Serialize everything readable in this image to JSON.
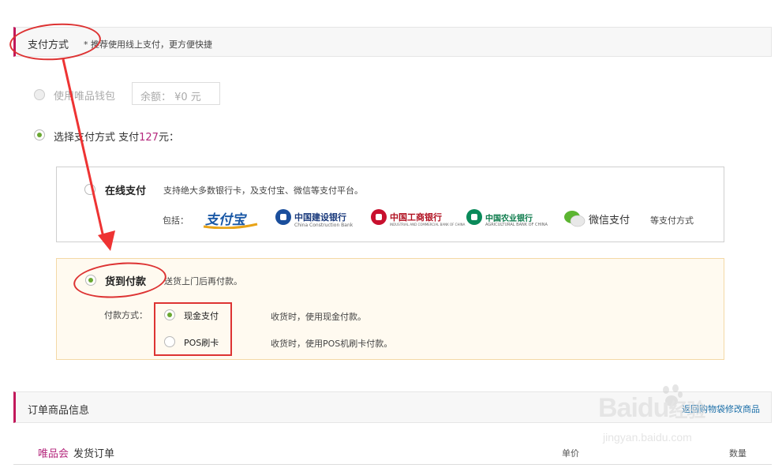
{
  "payment_section": {
    "title": "支付方式",
    "note": "* 推荐使用线上支付，更方便快捷"
  },
  "wallet": {
    "label": "使用唯品钱包",
    "balance": "余额： ¥0 元"
  },
  "choose": {
    "label_prefix": "选择支付方式 支付",
    "amount": "127",
    "label_suffix": "元："
  },
  "online": {
    "title": "在线支付",
    "desc": "支持绝大多数银行卡，及支付宝、微信等支付平台。",
    "includes_label": "包括：",
    "partners": [
      "支付宝",
      "中国建设银行",
      "中国工商银行",
      "中国农业银行",
      "微信支付"
    ],
    "partner_subtitles": [
      "China Construction Bank",
      "INDUSTRIAL AND COMMERCIAL BANK OF CHINA",
      "AGRICULTURAL BANK OF CHINA"
    ],
    "etc": "等支付方式"
  },
  "cod": {
    "title": "货到付款",
    "desc": "送货上门后再付款。",
    "method_label": "付款方式：",
    "options": [
      {
        "label": "现金支付",
        "desc": "收货时，使用现金付款。",
        "checked": true
      },
      {
        "label": "POS刷卡",
        "desc": "收货时，使用POS机刷卡付款。",
        "checked": false
      }
    ]
  },
  "order_section": {
    "title": "订单商品信息",
    "link": "返回购物袋修改商品",
    "brand": "唯品会",
    "order_title": "发货订单",
    "col_price": "单价",
    "col_qty": "数量"
  },
  "watermark": {
    "logo": "Baidu",
    "logo_suffix": "经验",
    "url": "jingyan.baidu.com"
  },
  "colors": {
    "accent": "#c2185b",
    "radio_checked": "#6aa832",
    "annotation_red": "#dd3333",
    "cod_bg": "#fffaf0",
    "amount": "#b5287d"
  }
}
